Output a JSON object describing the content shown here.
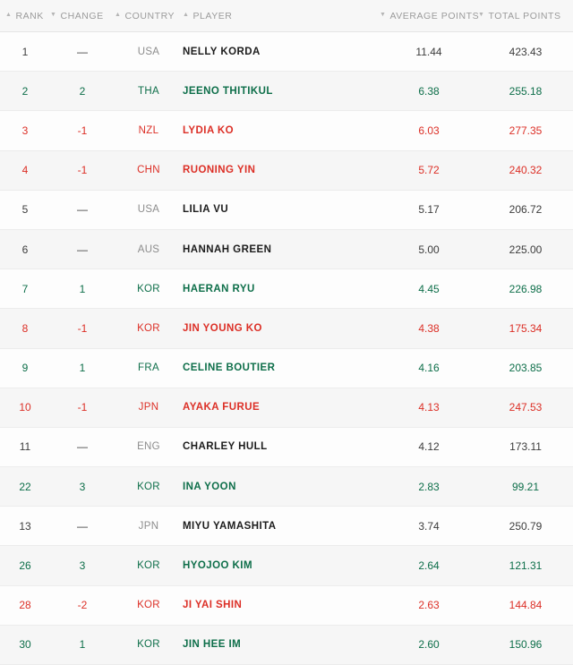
{
  "colors": {
    "up": "#0d6e49",
    "down": "#dc2f26",
    "neutral": "#3c3c3c",
    "muted": "#8c8c8c",
    "header_text": "#9b9b9b",
    "row_bg": "#fdfdfd",
    "row_bg_alt": "#f6f6f6",
    "divider": "#ececec"
  },
  "header": {
    "columns": [
      {
        "label": "RANK",
        "sort_icon": "sort-asc-icon",
        "glyph": "▲"
      },
      {
        "label": "CHANGE",
        "sort_icon": "sort-desc-icon",
        "glyph": "▼"
      },
      {
        "label": "COUNTRY",
        "sort_icon": "sort-asc-icon",
        "glyph": "▲"
      },
      {
        "label": "PLAYER",
        "sort_icon": "sort-asc-icon",
        "glyph": "▲"
      },
      {
        "label": "AVERAGE POINTS",
        "sort_icon": "sort-desc-icon",
        "glyph": "▼"
      },
      {
        "label": "TOTAL POINTS",
        "sort_icon": "sort-desc-icon",
        "glyph": "▼"
      }
    ]
  },
  "rows": [
    {
      "rank": "1",
      "change": "—",
      "country": "USA",
      "player": "NELLY KORDA",
      "average_points": "11.44",
      "total_points": "423.43",
      "movement": "none"
    },
    {
      "rank": "2",
      "change": "2",
      "country": "THA",
      "player": "JEENO THITIKUL",
      "average_points": "6.38",
      "total_points": "255.18",
      "movement": "up"
    },
    {
      "rank": "3",
      "change": "-1",
      "country": "NZL",
      "player": "LYDIA KO",
      "average_points": "6.03",
      "total_points": "277.35",
      "movement": "down"
    },
    {
      "rank": "4",
      "change": "-1",
      "country": "CHN",
      "player": "RUONING YIN",
      "average_points": "5.72",
      "total_points": "240.32",
      "movement": "down"
    },
    {
      "rank": "5",
      "change": "—",
      "country": "USA",
      "player": "LILIA VU",
      "average_points": "5.17",
      "total_points": "206.72",
      "movement": "none"
    },
    {
      "rank": "6",
      "change": "—",
      "country": "AUS",
      "player": "HANNAH GREEN",
      "average_points": "5.00",
      "total_points": "225.00",
      "movement": "none"
    },
    {
      "rank": "7",
      "change": "1",
      "country": "KOR",
      "player": "HAERAN RYU",
      "average_points": "4.45",
      "total_points": "226.98",
      "movement": "up"
    },
    {
      "rank": "8",
      "change": "-1",
      "country": "KOR",
      "player": "JIN YOUNG KO",
      "average_points": "4.38",
      "total_points": "175.34",
      "movement": "down"
    },
    {
      "rank": "9",
      "change": "1",
      "country": "FRA",
      "player": "CELINE BOUTIER",
      "average_points": "4.16",
      "total_points": "203.85",
      "movement": "up"
    },
    {
      "rank": "10",
      "change": "-1",
      "country": "JPN",
      "player": "AYAKA FURUE",
      "average_points": "4.13",
      "total_points": "247.53",
      "movement": "down"
    },
    {
      "rank": "11",
      "change": "—",
      "country": "ENG",
      "player": "CHARLEY HULL",
      "average_points": "4.12",
      "total_points": "173.11",
      "movement": "none"
    },
    {
      "rank": "22",
      "change": "3",
      "country": "KOR",
      "player": "INA YOON",
      "average_points": "2.83",
      "total_points": "99.21",
      "movement": "up"
    },
    {
      "rank": "13",
      "change": "—",
      "country": "JPN",
      "player": "MIYU YAMASHITA",
      "average_points": "3.74",
      "total_points": "250.79",
      "movement": "none"
    },
    {
      "rank": "26",
      "change": "3",
      "country": "KOR",
      "player": "HYOJOO KIM",
      "average_points": "2.64",
      "total_points": "121.31",
      "movement": "up"
    },
    {
      "rank": "28",
      "change": "-2",
      "country": "KOR",
      "player": "JI YAI SHIN",
      "average_points": "2.63",
      "total_points": "144.84",
      "movement": "down"
    },
    {
      "rank": "30",
      "change": "1",
      "country": "KOR",
      "player": "JIN HEE IM",
      "average_points": "2.60",
      "total_points": "150.96",
      "movement": "up"
    }
  ]
}
